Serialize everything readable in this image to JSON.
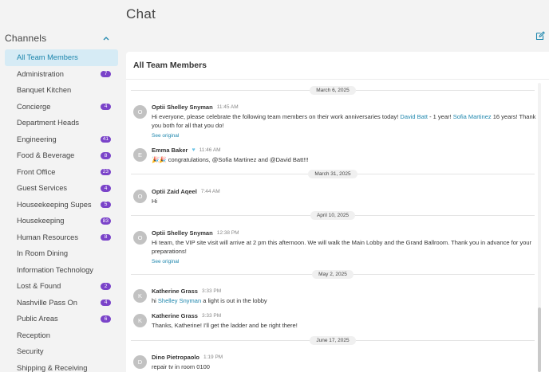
{
  "page": {
    "title": "Chat"
  },
  "sidebar": {
    "heading": "Channels",
    "channels": [
      {
        "label": "All Team Members",
        "badge": "",
        "active": true
      },
      {
        "label": "Administration",
        "badge": "7"
      },
      {
        "label": "Banquet Kitchen",
        "badge": ""
      },
      {
        "label": "Concierge",
        "badge": "4"
      },
      {
        "label": "Department Heads",
        "badge": ""
      },
      {
        "label": "Engineering",
        "badge": "41"
      },
      {
        "label": "Food & Beverage",
        "badge": "8"
      },
      {
        "label": "Front Office",
        "badge": "23"
      },
      {
        "label": "Guest Services",
        "badge": "4"
      },
      {
        "label": "Houseekeeping Supes",
        "badge": "5"
      },
      {
        "label": "Housekeeping",
        "badge": "83"
      },
      {
        "label": "Human Resources",
        "badge": "8"
      },
      {
        "label": "In Room Dining",
        "badge": ""
      },
      {
        "label": "Information Technology",
        "badge": ""
      },
      {
        "label": "Lost & Found",
        "badge": "2"
      },
      {
        "label": "Nashville Pass On",
        "badge": "4"
      },
      {
        "label": "Public Areas",
        "badge": "6"
      },
      {
        "label": "Reception",
        "badge": ""
      },
      {
        "label": "Security",
        "badge": ""
      },
      {
        "label": "Shipping & Receiving",
        "badge": ""
      }
    ]
  },
  "chat": {
    "header": "All Team Members",
    "see_original": "See original",
    "dates": [
      "March 6, 2025",
      "March 31, 2025",
      "April 10, 2025",
      "May 2, 2025",
      "June 17, 2025"
    ],
    "messages": [
      {
        "initial": "O",
        "author": "Optii Shelley Snyman",
        "time": "11:45 AM",
        "text_a": "Hi everyone, please celebrate the following team members on their work anniversaries today! ",
        "mention_1": "David Batt",
        "text_b": " - 1 year! ",
        "mention_2": "Sofia Martinez",
        "text_c": " 16 years! Thank you both for all that you do!"
      },
      {
        "initial": "E",
        "author": "Emma Baker",
        "time": "11:46 AM",
        "text": "🎉🎉 congratulations, @Sofia Martinez and @David Batt!!!"
      },
      {
        "initial": "O",
        "author": "Optii Zaid Aqeel",
        "time": "7:44 AM",
        "text": "Hi"
      },
      {
        "initial": "O",
        "author": "Optii Shelley Snyman",
        "time": "12:38 PM",
        "text": "Hi team, the VIP site visit will arrive at 2 pm this afternoon. We will walk the Main Lobby and the Grand Ballroom. Thank you in advance for your preparations!"
      },
      {
        "initial": "K",
        "author": "Katherine Grass",
        "time": "3:33 PM",
        "text_a": "hi ",
        "mention": "Shelley Snyman",
        "text_b": " a light is out in the lobby"
      },
      {
        "initial": "K",
        "author": "Katherine Grass",
        "time": "3:33 PM",
        "text": "Thanks, Katherine! I'll get the ladder and be right there!"
      },
      {
        "initial": "D",
        "author": "Dino Pietropaolo",
        "time": "1:19 PM",
        "text": "repair tv in room 0100"
      }
    ]
  },
  "colors": {
    "accent": "#1d86ad",
    "badge": "#7a43c9",
    "active_bg": "#d6ebf5"
  },
  "icons": {
    "collapse": "chevron-up-icon",
    "compose": "edit-icon"
  }
}
